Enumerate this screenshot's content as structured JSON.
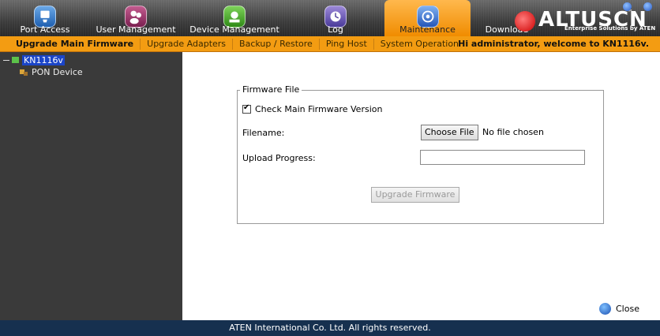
{
  "nav": {
    "items": [
      {
        "label": "Port Access",
        "icon": "port-access-icon"
      },
      {
        "label": "User Management",
        "icon": "users-icon"
      },
      {
        "label": "Device Management",
        "icon": "device-icon"
      },
      {
        "label": "Log",
        "icon": "log-icon"
      },
      {
        "label": "Maintenance",
        "icon": "maintenance-icon"
      },
      {
        "label": "Download",
        "icon": "download-icon"
      }
    ],
    "active": "Maintenance"
  },
  "brand": {
    "name": "ALTUSCN",
    "trademark": "™",
    "tagline": "Enterprise Solutions by ATEN"
  },
  "subnav": {
    "tabs": [
      "Upgrade Main Firmware",
      "Upgrade Adapters",
      "Backup / Restore",
      "Ping Host",
      "System Operation"
    ],
    "active": "Upgrade Main Firmware",
    "welcome": "Hi administrator, welcome to KN1116v."
  },
  "tree": {
    "root": "KN1116v",
    "child": "PON Device"
  },
  "firmware": {
    "legend": "Firmware File",
    "check_label": "Check Main Firmware Version",
    "check_checked": true,
    "filename_label": "Filename:",
    "choose_button": "Choose File",
    "no_file": "No file chosen",
    "progress_label": "Upload Progress:",
    "progress_value": 0,
    "upgrade_button": "Upgrade Firmware"
  },
  "close_label": "Close",
  "footer": "ATEN International Co. Ltd. All rights reserved.",
  "colors": {
    "accent": "#f39c12",
    "footer": "#16304f",
    "sidebar": "#3a3a3a",
    "selection": "#1b45c8"
  }
}
